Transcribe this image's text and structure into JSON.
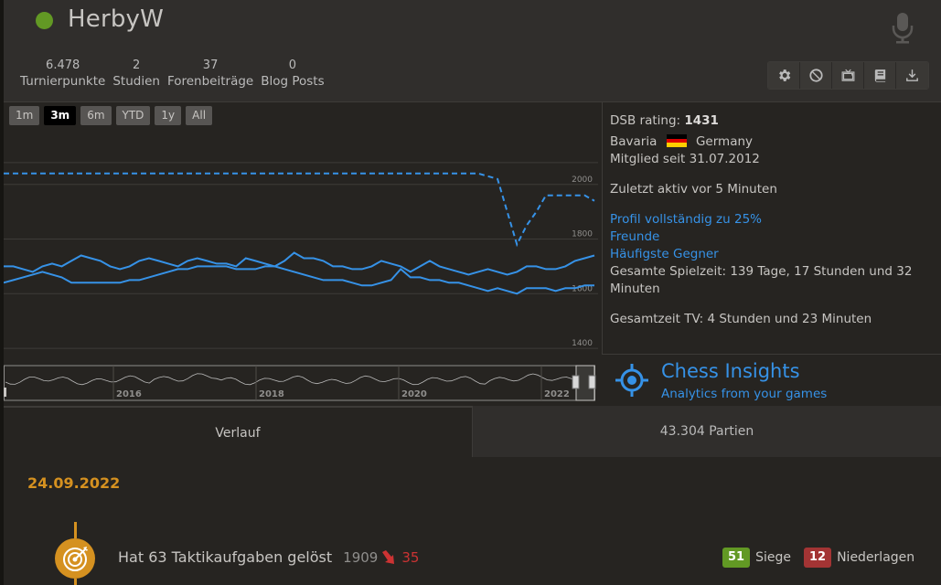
{
  "profile": {
    "username": "HerbyW",
    "online": true,
    "stats": [
      {
        "num": "6.478",
        "label": "Turnierpunkte"
      },
      {
        "num": "2",
        "label": "Studien"
      },
      {
        "num": "37",
        "label": "Forenbeiträge"
      },
      {
        "num": "0",
        "label": "Blog Posts"
      }
    ],
    "actions": [
      "gear-icon",
      "block-icon",
      "tv-icon",
      "book-icon",
      "download-icon"
    ]
  },
  "chart": {
    "ranges": [
      "1m",
      "3m",
      "6m",
      "YTD",
      "1y",
      "All"
    ],
    "active_range": "3m",
    "y_ticks": [
      "2000",
      "1800",
      "1600",
      "1400"
    ],
    "nav_years": [
      "2016",
      "2018",
      "2020",
      "2022"
    ]
  },
  "chart_data": {
    "type": "line",
    "ylim": [
      1340,
      2200
    ],
    "series": [
      {
        "style": "dashed",
        "values": [
          2040,
          2040,
          2040,
          2040,
          2040,
          2040,
          2040,
          2040,
          2040,
          2040,
          2040,
          2040,
          2040,
          2040,
          2040,
          2040,
          2040,
          2040,
          2040,
          2040,
          2040,
          2040,
          2040,
          2040,
          2040,
          2040,
          2040,
          2040,
          2040,
          2040,
          2040,
          2040,
          2040,
          2040,
          2040,
          2040,
          2040,
          2040,
          2040,
          2040,
          2040,
          2040,
          2040,
          2040,
          2040,
          2040,
          2040,
          2040,
          2040,
          2040,
          2030,
          2020,
          1900,
          1780,
          1850,
          1900,
          1960,
          1960,
          1960,
          1960,
          1960,
          1940
        ]
      },
      {
        "style": "solid",
        "values": [
          1700,
          1700,
          1690,
          1680,
          1700,
          1710,
          1700,
          1720,
          1740,
          1730,
          1720,
          1700,
          1690,
          1700,
          1720,
          1730,
          1720,
          1710,
          1700,
          1720,
          1730,
          1720,
          1710,
          1710,
          1700,
          1730,
          1720,
          1710,
          1700,
          1720,
          1750,
          1730,
          1730,
          1720,
          1700,
          1700,
          1690,
          1690,
          1700,
          1720,
          1710,
          1700,
          1680,
          1700,
          1720,
          1700,
          1690,
          1680,
          1670,
          1680,
          1690,
          1680,
          1670,
          1680,
          1700,
          1700,
          1690,
          1690,
          1700,
          1720,
          1730,
          1740
        ]
      },
      {
        "style": "solid",
        "values": [
          1640,
          1650,
          1660,
          1670,
          1680,
          1670,
          1660,
          1640,
          1640,
          1640,
          1640,
          1640,
          1640,
          1650,
          1650,
          1660,
          1670,
          1680,
          1690,
          1690,
          1700,
          1700,
          1700,
          1700,
          1690,
          1690,
          1690,
          1700,
          1700,
          1690,
          1680,
          1670,
          1660,
          1650,
          1650,
          1650,
          1640,
          1630,
          1630,
          1640,
          1650,
          1690,
          1660,
          1660,
          1650,
          1650,
          1640,
          1640,
          1630,
          1620,
          1610,
          1620,
          1610,
          1600,
          1620,
          1620,
          1620,
          1610,
          1620,
          1620,
          1630,
          1630
        ]
      }
    ],
    "navigator_x_labels": [
      "2016",
      "2018",
      "2020",
      "2022"
    ]
  },
  "info": {
    "dsb_label": "DSB rating:",
    "dsb_value": "1431",
    "region": "Bavaria",
    "country": "Germany",
    "member_since": "Mitglied seit 31.07.2012",
    "last_active": "Zuletzt aktiv vor 5 Minuten",
    "profile_complete": "Profil vollständig zu 25%",
    "friends": "Freunde",
    "opponents": "Häufigste Gegner",
    "playtime": "Gesamte Spielzeit: 139 Tage, 17 Stunden und 32 Minuten",
    "tv_time": "Gesamtzeit TV: 4 Stunden und 23 Minuten"
  },
  "insights": {
    "title": "Chess Insights",
    "subtitle": "Analytics from your games"
  },
  "tabs": [
    {
      "label": "Verlauf",
      "active": true
    },
    {
      "label": "43.304 Partien",
      "active": false
    }
  ],
  "activity": {
    "date": "24.09.2022",
    "text": "Hat 63 Taktikaufgaben gelöst",
    "rating": "1909",
    "change": "35",
    "wins": "51",
    "wins_label": "Siege",
    "losses": "12",
    "losses_label": "Niederlagen"
  },
  "colors": {
    "accent": "#3692e7",
    "date": "#d59120",
    "win": "#629924",
    "loss": "#a33434"
  }
}
